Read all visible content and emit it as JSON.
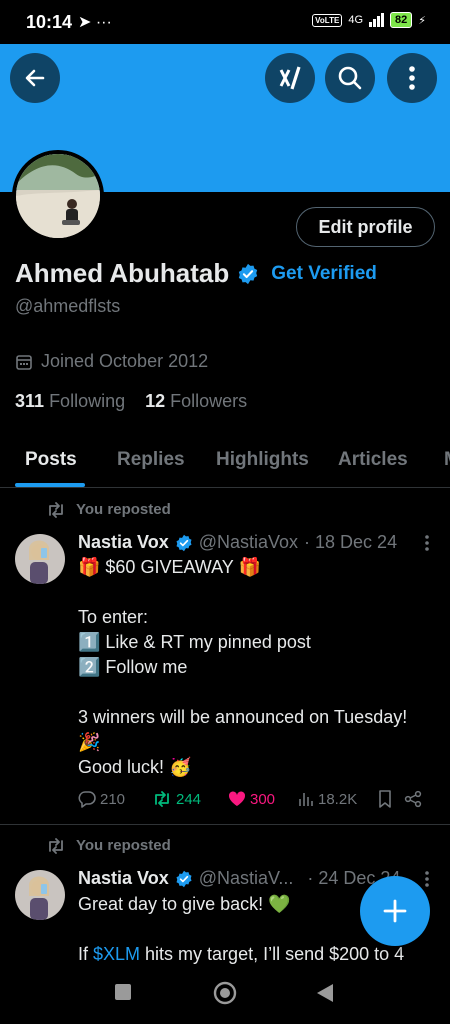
{
  "status_bar": {
    "time": "10:14",
    "left_icons": "➤ ···",
    "volte": "VoLTE",
    "network": "4G",
    "battery": "82"
  },
  "header": {
    "back": "back-arrow-icon",
    "grok": "grok-icon",
    "search": "search-icon",
    "more": "more-vertical-icon",
    "banner_color": "#1d9bf0"
  },
  "profile": {
    "edit_label": "Edit profile",
    "name": "Ahmed Abuhatab",
    "get_verified": "Get Verified",
    "handle": "@ahmedflsts",
    "joined": "Joined October 2012",
    "following_count": "311",
    "following_label": "Following",
    "followers_count": "12",
    "followers_label": "Followers"
  },
  "tabs": [
    {
      "label": "Posts"
    },
    {
      "label": "Replies"
    },
    {
      "label": "Highlights"
    },
    {
      "label": "Articles"
    }
  ],
  "tweets": [
    {
      "repost_label": "You reposted",
      "name": "Nastia Vox",
      "handle": "@NastiaVox",
      "date": "· 18 Dec 24",
      "lines": [
        "🎁 $60 GIVEAWAY 🎁",
        "",
        "To enter:",
        "1️⃣ Like & RT my pinned post",
        "2️⃣ Follow me",
        "",
        "3 winners will be announced on Tuesday!",
        "🎉",
        "Good luck! 🥳"
      ],
      "replies": "210",
      "reposts": "244",
      "likes": "300",
      "views": "18.2K"
    },
    {
      "repost_label": "You reposted",
      "name": "Nastia Vox",
      "handle": "@NastiaV...",
      "date": "· 24 Dec 24",
      "line1": "Great day to give back! 💚",
      "line2_pre": "If ",
      "cashtag": "$XLM",
      "line2_post": " hits my target, I’ll send $200 to 4"
    }
  ],
  "colors": {
    "accent": "#1d9bf0",
    "repost_green": "#00ba7c",
    "like_pink": "#f91880"
  }
}
